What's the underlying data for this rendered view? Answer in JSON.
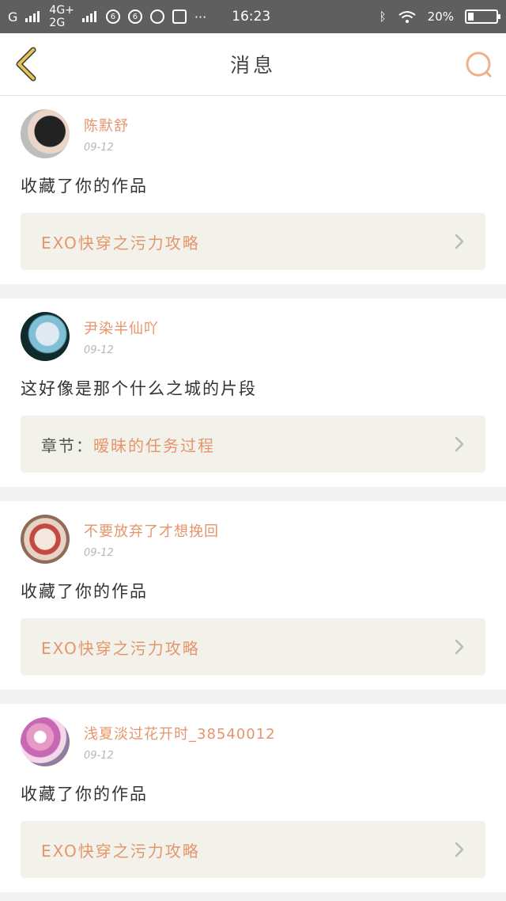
{
  "status_bar": {
    "carrier": "G",
    "net_top": "4G+",
    "net_bottom": "2G",
    "time": "16:23",
    "battery": "20%",
    "battery_level": 0.2,
    "dots": "···"
  },
  "header": {
    "title": "消息",
    "back_icon": "chevron-left-icon",
    "search_icon": "search-icon"
  },
  "colors": {
    "accent": "#e5956b",
    "back_icon": "#e2c84f",
    "search_icon": "#f0b08a"
  },
  "messages": [
    {
      "user": "陈默舒",
      "date": "09-12",
      "text": "收藏了你的作品",
      "work_prefix": "",
      "work_title": "EXO快穿之污力攻略"
    },
    {
      "user": "尹染半仙吖",
      "date": "09-12",
      "text": "这好像是那个什么之城的片段",
      "work_prefix": "章节：",
      "work_title": "暧昧的任务过程"
    },
    {
      "user": "不要放弃了才想挽回",
      "date": "09-12",
      "text": "收藏了你的作品",
      "work_prefix": "",
      "work_title": "EXO快穿之污力攻略"
    },
    {
      "user": "浅夏淡过花开时_38540012",
      "date": "09-12",
      "text": "收藏了你的作品",
      "work_prefix": "",
      "work_title": "EXO快穿之污力攻略"
    }
  ]
}
